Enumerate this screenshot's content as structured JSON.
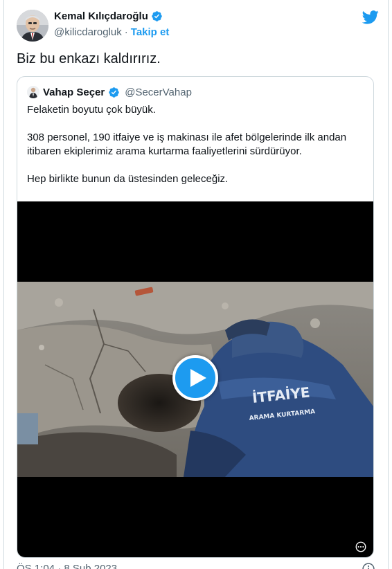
{
  "author": {
    "name": "Kemal Kılıçdaroğlu",
    "handle": "@kilicdarogluk",
    "separator": "·",
    "follow_label": "Takip et"
  },
  "tweet": {
    "text": "Biz bu enkazı kaldırırız."
  },
  "quoted": {
    "name": "Vahap Seçer",
    "handle": "@SecerVahap",
    "paragraphs": [
      "Felaketin boyutu çok büyük.",
      "308 personel, 190 itfaiye ve iş makinası ile afet bölgelerinde ilk andan itibaren ekiplerimiz arama kurtarma faaliyetlerini sürdürüyor.",
      "Hep birlikte bunun da üstesinden geleceğiz."
    ],
    "video": {
      "jacket_text_1": "İTFAİYE",
      "jacket_text_2": "ARAMA KURTARMA"
    }
  },
  "timestamp": "ÖS 1:04 · 8 Şub 2023",
  "colors": {
    "accent": "#1d9bf0",
    "text": "#0f1419",
    "muted": "#536471",
    "border": "#cfd9de"
  },
  "icons": [
    "verified-badge-icon",
    "twitter-bird-icon",
    "play-icon",
    "more-icon",
    "info-icon"
  ]
}
